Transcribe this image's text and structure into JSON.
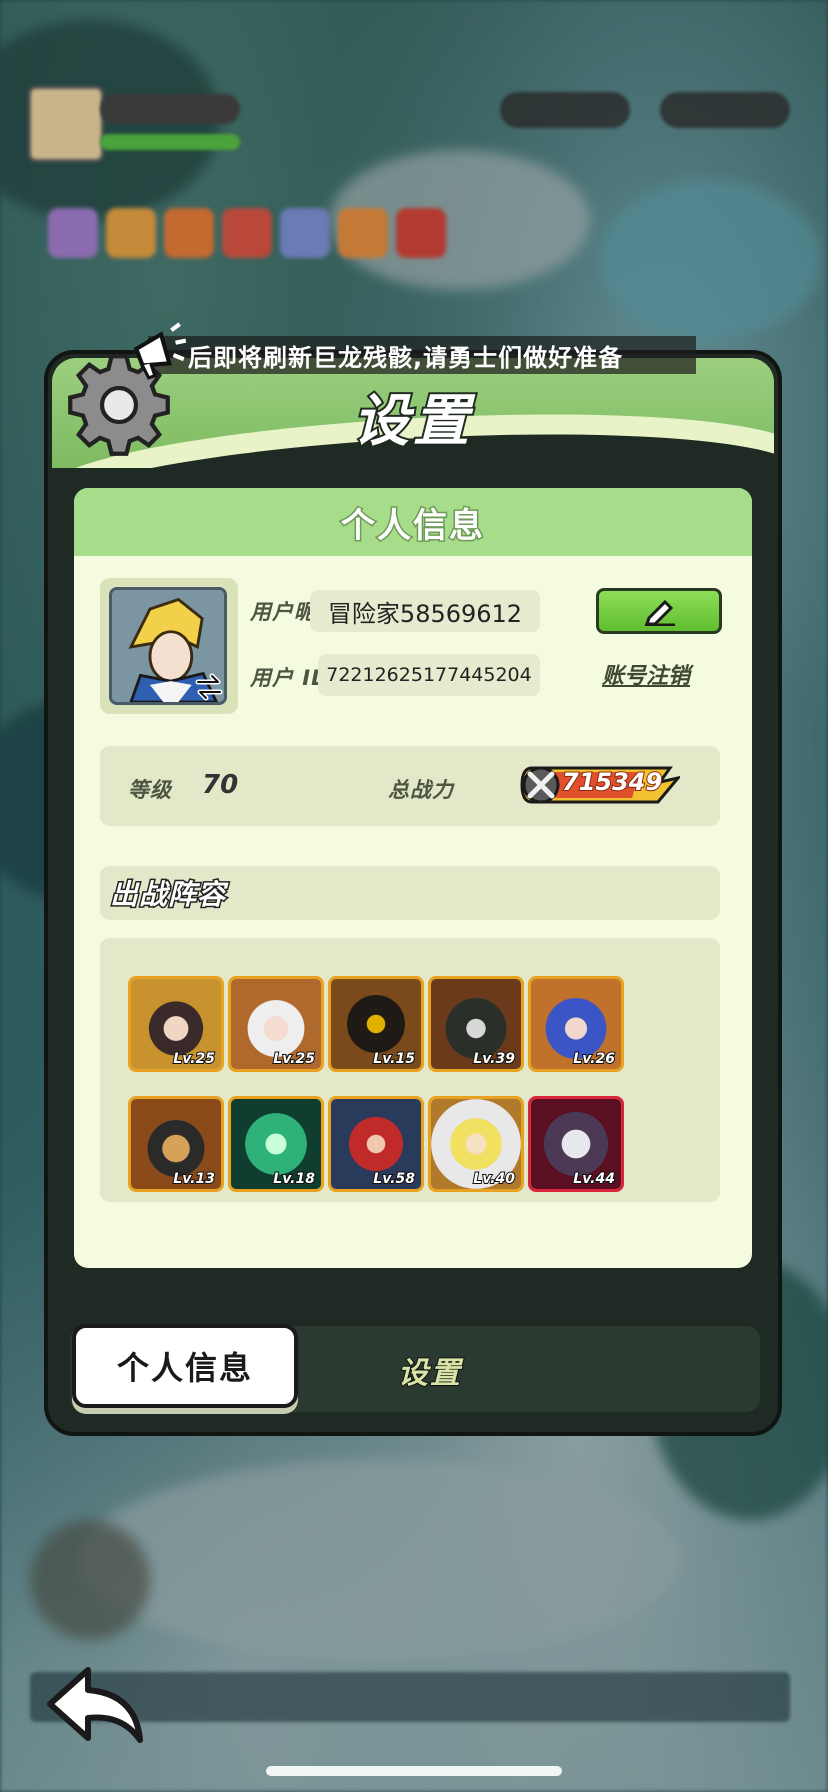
{
  "announcement": "后即将刷新巨龙残骸,请勇士们做好准备",
  "panel": {
    "title": "设置"
  },
  "profile": {
    "section_title": "个人信息",
    "nickname_label": "用户昵称",
    "nickname_value": "冒险家58569612",
    "id_label": "用户 ID",
    "id_value": "72212625177445204",
    "edit_icon": "pencil-icon",
    "logout_label": "账号注销",
    "level_label": "等级",
    "level_value": "70",
    "power_label": "总战力",
    "power_value": "715349"
  },
  "lineup": {
    "title": "出战阵容",
    "heroes": [
      {
        "lv": "Lv.25",
        "rarity": "gold"
      },
      {
        "lv": "Lv.25",
        "rarity": "gold"
      },
      {
        "lv": "Lv.15",
        "rarity": "gold"
      },
      {
        "lv": "Lv.39",
        "rarity": "gold"
      },
      {
        "lv": "Lv.26",
        "rarity": "gold"
      },
      {
        "lv": "Lv.13",
        "rarity": "gold"
      },
      {
        "lv": "Lv.18",
        "rarity": "gold"
      },
      {
        "lv": "Lv.58",
        "rarity": "gold"
      },
      {
        "lv": "Lv.40",
        "rarity": "gold"
      },
      {
        "lv": "Lv.44",
        "rarity": "red"
      }
    ]
  },
  "tabs": [
    {
      "label": "个人信息",
      "active": true
    },
    {
      "label": "设置",
      "active": false
    }
  ],
  "colors": {
    "accent_green": "#7dbb61",
    "card_bg": "#f5fbdf",
    "gold_frame": "#e8a21f",
    "red_frame": "#d9263a"
  }
}
